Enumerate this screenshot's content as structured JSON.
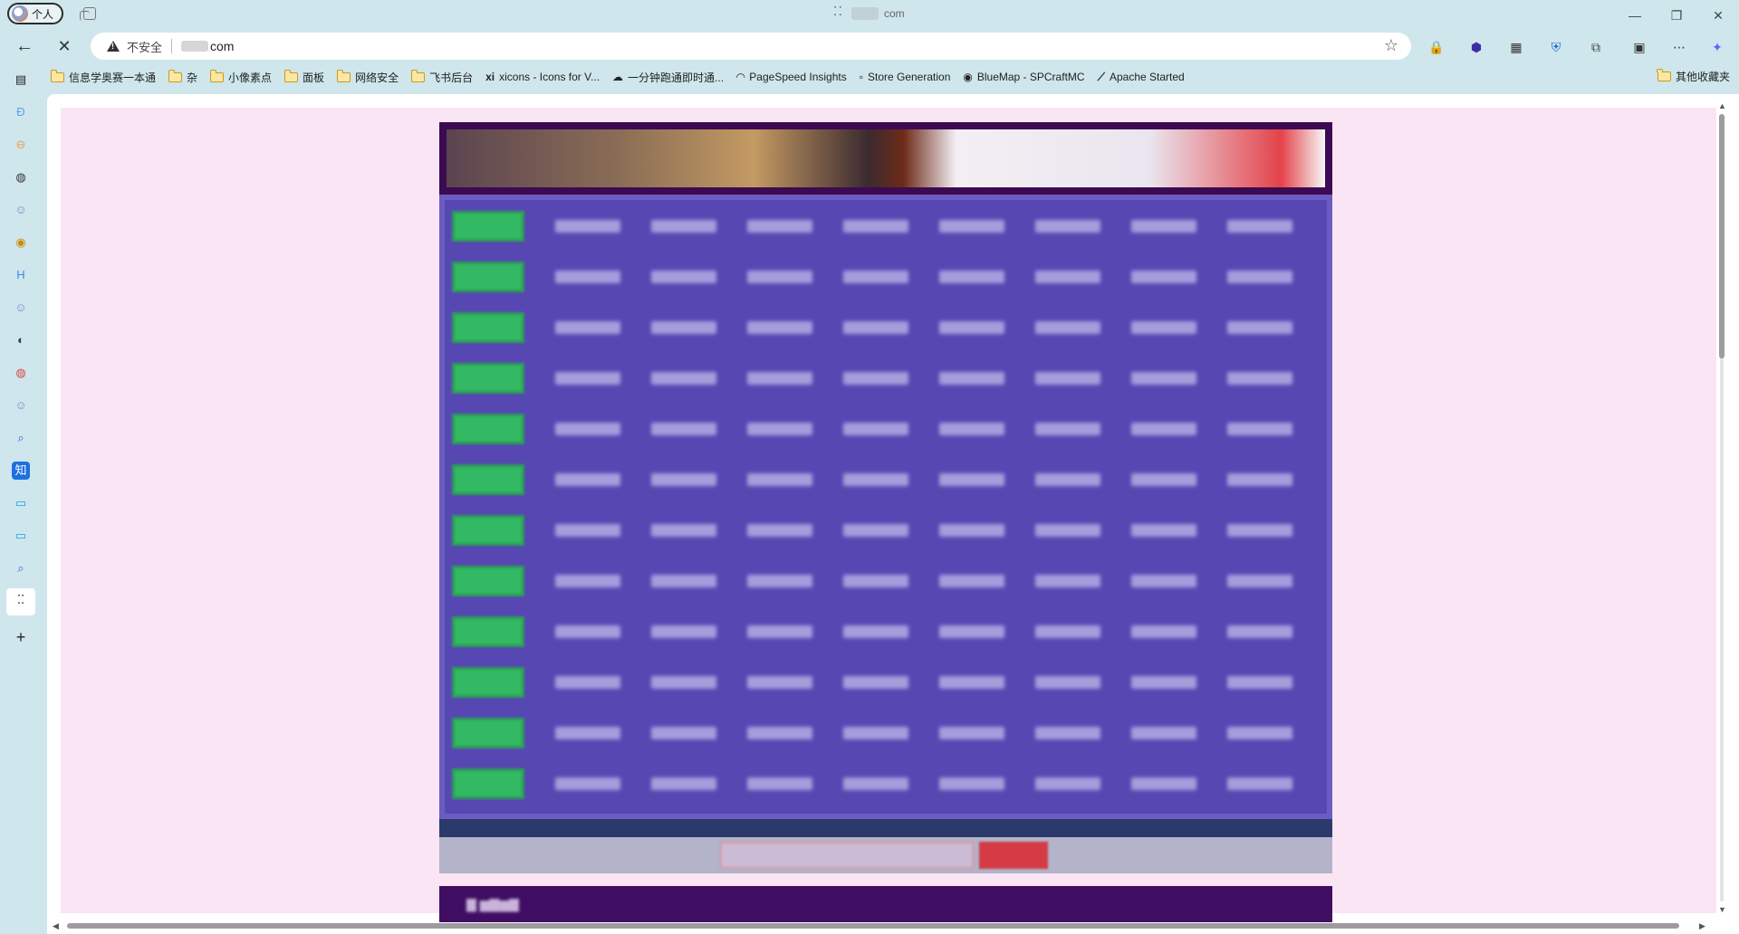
{
  "window": {
    "profile_label": "个人",
    "tab_title_suffix": "com",
    "minimize": "—",
    "restore": "❐",
    "close": "✕"
  },
  "toolbar": {
    "security_label": "不安全",
    "url_suffix": "com"
  },
  "bookmarks": [
    {
      "label": "信息学奥赛一本通",
      "icon": "folder-icon"
    },
    {
      "label": "杂",
      "icon": "folder-icon"
    },
    {
      "label": "小像素点",
      "icon": "folder-icon"
    },
    {
      "label": "面板",
      "icon": "folder-icon"
    },
    {
      "label": "网络安全",
      "icon": "folder-icon"
    },
    {
      "label": "飞书后台",
      "icon": "folder-icon"
    },
    {
      "label": "xicons - Icons for V...",
      "icon": "xi-icon",
      "glyph": "xi"
    },
    {
      "label": "一分钟跑通即时通...",
      "icon": "cloud-icon",
      "glyph": "☁"
    },
    {
      "label": "PageSpeed Insights",
      "icon": "pagespeed-icon",
      "glyph": "◠"
    },
    {
      "label": "Store Generation",
      "icon": "store-icon",
      "glyph": "▫"
    },
    {
      "label": "BlueMap - SPCraftMC",
      "icon": "bluemap-icon",
      "glyph": "◉"
    },
    {
      "label": "Apache Started",
      "icon": "apache-icon",
      "glyph": "⟋"
    }
  ],
  "other_bookmarks": "其他收藏夹",
  "content": {
    "rows": 12,
    "cols": 8
  },
  "colors": {
    "page_bg": "#fae5f4",
    "grid_bg": "#5747b3",
    "tag_green": "#33b864",
    "banner_bg": "#3c0a52",
    "search_button": "#d43b45"
  }
}
